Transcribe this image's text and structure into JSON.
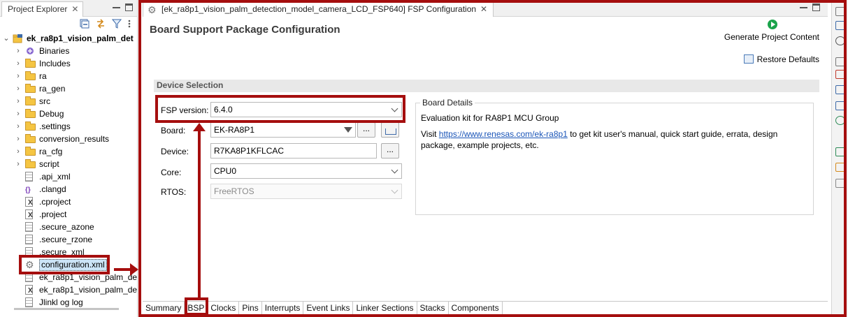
{
  "explorer": {
    "tab_label": "Project Explorer",
    "project_name": "ek_ra8p1_vision_palm_det",
    "items": [
      {
        "label": "Binaries",
        "kind": "binaries",
        "expandable": true
      },
      {
        "label": "Includes",
        "kind": "includes",
        "expandable": true
      },
      {
        "label": "ra",
        "kind": "folder",
        "expandable": true
      },
      {
        "label": "ra_gen",
        "kind": "folder",
        "expandable": true
      },
      {
        "label": "src",
        "kind": "folder",
        "expandable": true
      },
      {
        "label": "Debug",
        "kind": "folder",
        "expandable": true
      },
      {
        "label": ".settings",
        "kind": "folder",
        "expandable": true
      },
      {
        "label": "conversion_results",
        "kind": "folder",
        "expandable": true
      },
      {
        "label": "ra_cfg",
        "kind": "folder",
        "expandable": true
      },
      {
        "label": "script",
        "kind": "folder",
        "expandable": true
      },
      {
        "label": ".api_xml",
        "kind": "file",
        "expandable": false
      },
      {
        "label": ".clangd",
        "kind": "clangd",
        "expandable": false
      },
      {
        "label": ".cproject",
        "kind": "xml",
        "expandable": false
      },
      {
        "label": ".project",
        "kind": "xml",
        "expandable": false
      },
      {
        "label": ".secure_azone",
        "kind": "file",
        "expandable": false
      },
      {
        "label": ".secure_rzone",
        "kind": "file",
        "expandable": false
      },
      {
        "label": ".secure_xml",
        "kind": "file",
        "expandable": false
      },
      {
        "label": "configuration.xml",
        "kind": "config",
        "expandable": false,
        "selected": true
      },
      {
        "label": "ek_ra8p1_vision_palm_de",
        "kind": "file",
        "expandable": false
      },
      {
        "label": "ek_ra8p1_vision_palm_de",
        "kind": "xml",
        "expandable": false
      },
      {
        "label": "Jlinkl og log",
        "kind": "file",
        "expandable": false
      }
    ]
  },
  "editor": {
    "tab_label": "[ek_ra8p1_vision_palm_detection_model_camera_LCD_FSP640] FSP Configuration",
    "page_title": "Board Support Package Configuration",
    "generate_label": "Generate Project Content",
    "restore_label": "Restore Defaults",
    "section_title": "Device Selection",
    "fsp_version_label": "FSP version:",
    "fsp_version_value": "6.4.0",
    "board_label": "Board:",
    "board_value": "EK-RA8P1",
    "device_label": "Device:",
    "device_value": "R7KA8P1KFLCAC",
    "core_label": "Core:",
    "core_value": "CPU0",
    "rtos_label": "RTOS:",
    "rtos_value": "FreeRTOS",
    "browse_label": "...",
    "board_details": {
      "legend": "Board Details",
      "line1": "Evaluation kit for RA8P1 MCU Group",
      "visit": "Visit ",
      "link": "https://www.renesas.com/ek-ra8p1",
      "rest": " to get kit user's manual, quick start guide, errata, design package, example projects, etc."
    },
    "bottom_tabs": [
      "Summary",
      "BSP",
      "Clocks",
      "Pins",
      "Interrupts",
      "Event Links",
      "Linker Sections",
      "Stacks",
      "Components"
    ],
    "selected_tab": "BSP"
  },
  "colors": {
    "annotation": "#a50e0e",
    "link": "#1a55b8",
    "generate_icon": "#1aa34a"
  },
  "trim_icons": [
    "restore-icon",
    "outline-icon",
    "robot-icon",
    "minimize-icon",
    "properties-icon",
    "console-icon",
    "table-icon",
    "globe-icon",
    "memory-icon",
    "pin-icon",
    "cloud-icon"
  ]
}
